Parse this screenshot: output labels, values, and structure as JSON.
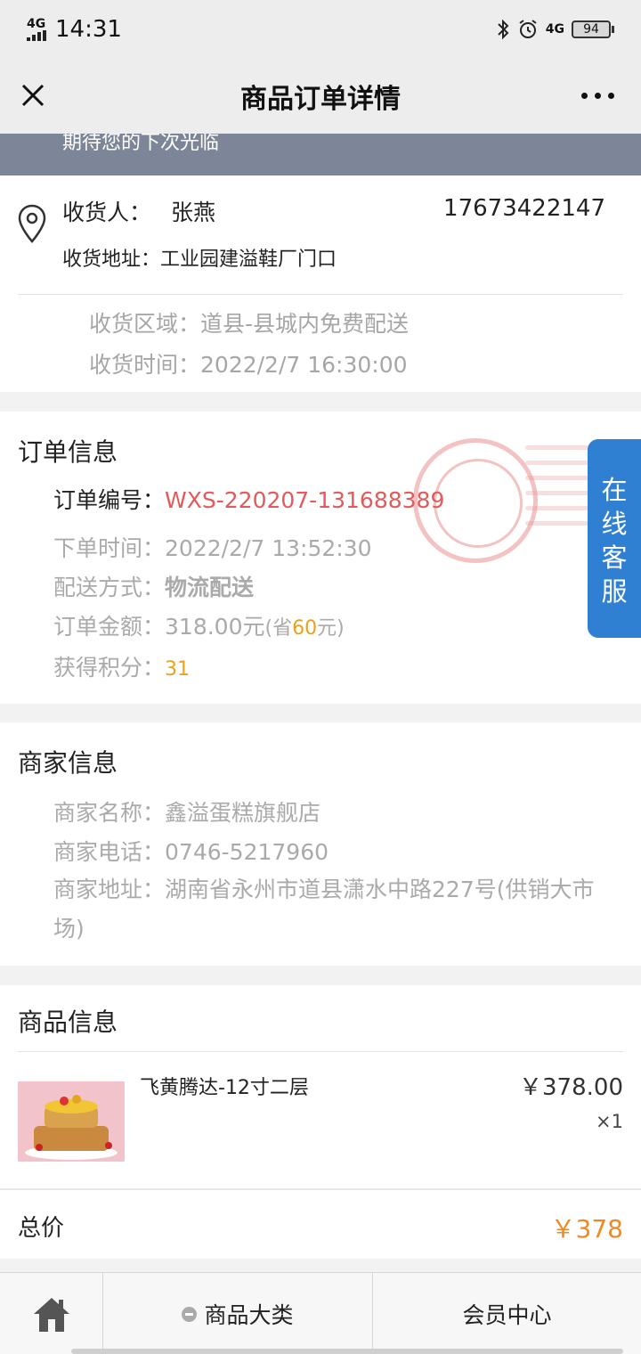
{
  "status": {
    "network_left": "4G",
    "time": "14:31",
    "network_right": "4G",
    "battery": "94"
  },
  "header": {
    "title": "商品订单详情"
  },
  "banner": {
    "text": "期待您的下次光临"
  },
  "shipping": {
    "receiver_label": "收货人：",
    "receiver_name": "张燕",
    "phone": "17673422147",
    "address_label": "收货地址：",
    "address": "工业园建溢鞋厂门口",
    "area_label": "收货区域：",
    "area": "道县-县城内免费配送",
    "time_label": "收货时间：",
    "time": "2022/2/7 16:30:00"
  },
  "order": {
    "title": "订单信息",
    "number_label": "订单编号：",
    "number": "WXS-220207-131688389",
    "created_label": "下单时间：",
    "created": "2022/2/7 13:52:30",
    "delivery_label": "配送方式：",
    "delivery": "物流配送",
    "amount_label": "订单金额：",
    "amount": "318.00元",
    "saved_prefix": "(省",
    "saved_value": "60",
    "saved_suffix": "元)",
    "points_label": "获得积分：",
    "points": "31"
  },
  "service_tab": {
    "chars": [
      "在",
      "线",
      "客",
      "服"
    ]
  },
  "merchant": {
    "title": "商家信息",
    "name_label": "商家名称：",
    "name": "鑫溢蛋糕旗舰店",
    "phone_label": "商家电话：",
    "phone": "0746-5217960",
    "address_label": "商家地址：",
    "address": "湖南省永州市道县潇水中路227号(供销大市场)"
  },
  "goods": {
    "title": "商品信息",
    "item_name": "飞黄腾达-12寸二层",
    "price": "￥378.00",
    "qty": "×1",
    "total_label": "总价",
    "total_value": "￥378"
  },
  "nav": {
    "category": "商品大类",
    "member": "会员中心"
  },
  "colors": {
    "accent_red": "#e45a5a",
    "accent_orange": "#f08a24",
    "service_blue": "#2f7fd3"
  }
}
